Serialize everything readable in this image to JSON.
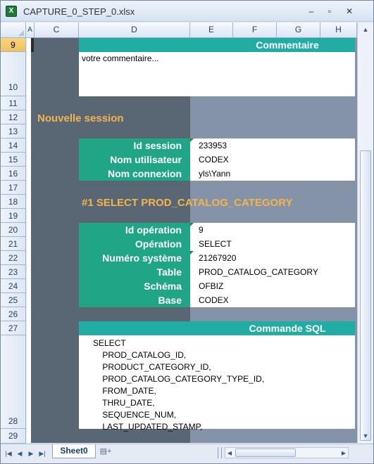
{
  "window": {
    "title": "CAPTURE_0_STEP_0.xlsx",
    "app_icon": "excel-icon",
    "minimize": "–",
    "maximize": "▫",
    "close": "✕"
  },
  "columns": [
    "A",
    "C",
    "D",
    "E",
    "F",
    "G",
    "H"
  ],
  "rows": [
    "9",
    "10",
    "11",
    "12",
    "13",
    "14",
    "15",
    "16",
    "17",
    "18",
    "19",
    "20",
    "21",
    "22",
    "23",
    "24",
    "25",
    "26",
    "27",
    "28",
    "29"
  ],
  "selected_row": "9",
  "comment": {
    "header": "Commentaire",
    "text": "votre commentaire..."
  },
  "session": {
    "heading": "Nouvelle session",
    "fields": [
      {
        "label": "Id session",
        "value": "233953"
      },
      {
        "label": "Nom utilisateur",
        "value": "CODEX"
      },
      {
        "label": "Nom connexion",
        "value": "yls\\Yann"
      }
    ]
  },
  "operation": {
    "heading": "#1 SELECT PROD_CATALOG_CATEGORY",
    "fields": [
      {
        "label": "Id opération",
        "value": "9"
      },
      {
        "label": "Opération",
        "value": "SELECT"
      },
      {
        "label": "Numéro système",
        "value": "21267920"
      },
      {
        "label": "Table",
        "value": "PROD_CATALOG_CATEGORY"
      },
      {
        "label": "Schéma",
        "value": "OFBIZ"
      },
      {
        "label": "Base",
        "value": "CODEX"
      }
    ]
  },
  "sql": {
    "header": "Commande SQL",
    "lines": [
      "SELECT",
      "    PROD_CATALOG_ID,",
      "    PRODUCT_CATEGORY_ID,",
      "    PROD_CATALOG_CATEGORY_TYPE_ID,",
      "    FROM_DATE,",
      "    THRU_DATE,",
      "    SEQUENCE_NUM,",
      "    LAST_UPDATED_STAMP,"
    ]
  },
  "sheet_tabs": {
    "active": "Sheet0",
    "nav_first": "|◀",
    "nav_prev": "◀",
    "nav_next": "▶",
    "nav_last": "▶|"
  },
  "colors": {
    "dark_panel": "#596775",
    "gray_panel": "#8593a8",
    "teal_header": "#22ada4",
    "label_green": "#20a686",
    "heading_orange": "#f4b44a"
  }
}
